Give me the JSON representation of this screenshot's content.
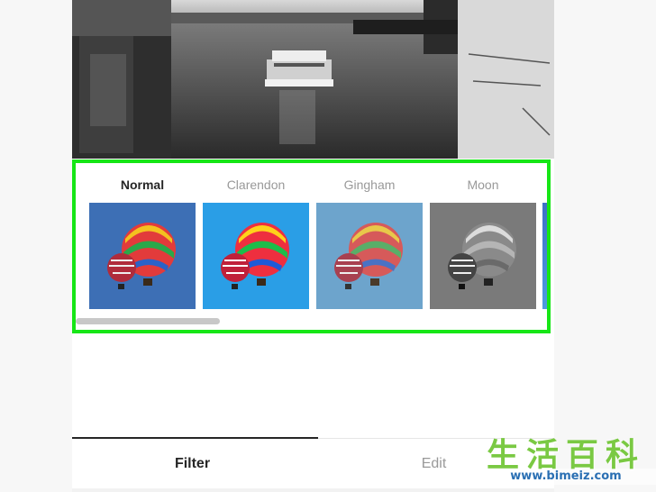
{
  "preview": {
    "description_icon": "black-and-white-river-photo"
  },
  "filters": {
    "items": [
      {
        "label": "Normal",
        "active": true
      },
      {
        "label": "Clarendon",
        "active": false
      },
      {
        "label": "Gingham",
        "active": false
      },
      {
        "label": "Moon",
        "active": false
      }
    ],
    "highlight_color": "#16e616"
  },
  "tabs": {
    "filter_label": "Filter",
    "edit_label": "Edit",
    "active": "Filter"
  },
  "watermark": {
    "title": "生活百科",
    "url": "www.bimeiz.com"
  }
}
